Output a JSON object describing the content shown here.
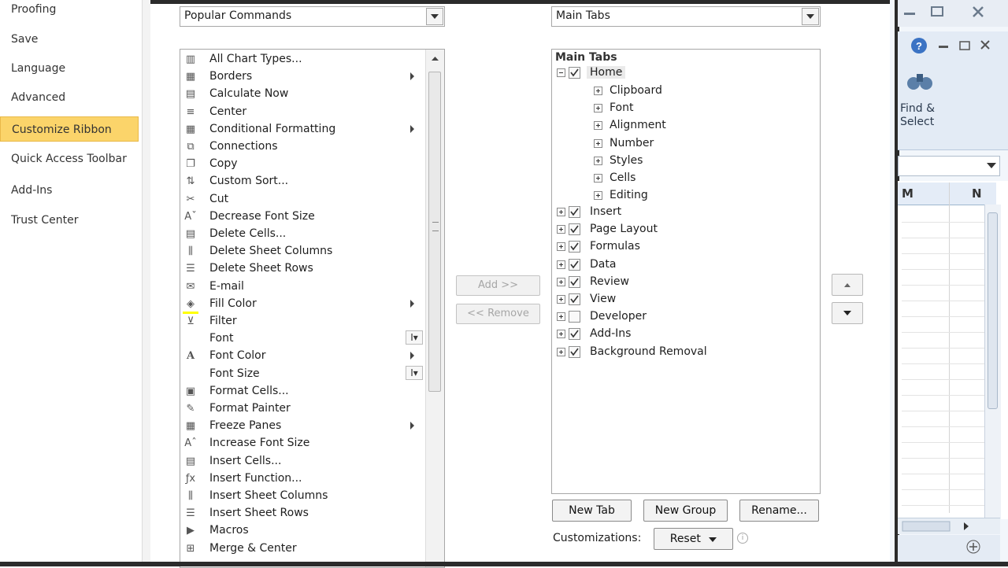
{
  "nav": {
    "items": [
      {
        "label": "Proofing",
        "active": false
      },
      {
        "label": "Save",
        "active": false
      },
      {
        "label": "Language",
        "active": false
      },
      {
        "label": "Advanced",
        "active": false
      },
      {
        "label": "Customize Ribbon",
        "active": true
      },
      {
        "label": "Quick Access Toolbar",
        "active": false
      },
      {
        "label": "Add-Ins",
        "active": false
      },
      {
        "label": "Trust Center",
        "active": false
      }
    ]
  },
  "choose_commands": {
    "selected": "Popular Commands"
  },
  "customize_ribbon": {
    "selected": "Main Tabs"
  },
  "commands": [
    {
      "label": "All Chart Types...",
      "icon": "chart-icon",
      "submenu": false
    },
    {
      "label": "Borders",
      "icon": "borders-icon",
      "submenu": true
    },
    {
      "label": "Calculate Now",
      "icon": "calculator-icon",
      "submenu": false
    },
    {
      "label": "Center",
      "icon": "align-center-icon",
      "submenu": false
    },
    {
      "label": "Conditional Formatting",
      "icon": "conditional-formatting-icon",
      "submenu": true
    },
    {
      "label": "Connections",
      "icon": "connections-icon",
      "submenu": false
    },
    {
      "label": "Copy",
      "icon": "copy-icon",
      "submenu": false
    },
    {
      "label": "Custom Sort...",
      "icon": "sort-icon",
      "submenu": false
    },
    {
      "label": "Cut",
      "icon": "scissors-icon",
      "submenu": false
    },
    {
      "label": "Decrease Font Size",
      "icon": "decrease-font-icon",
      "submenu": false
    },
    {
      "label": "Delete Cells...",
      "icon": "delete-cells-icon",
      "submenu": false
    },
    {
      "label": "Delete Sheet Columns",
      "icon": "delete-columns-icon",
      "submenu": false
    },
    {
      "label": "Delete Sheet Rows",
      "icon": "delete-rows-icon",
      "submenu": false
    },
    {
      "label": "E-mail",
      "icon": "email-icon",
      "submenu": false
    },
    {
      "label": "Fill Color",
      "icon": "fill-color-icon",
      "submenu": true
    },
    {
      "label": "Filter",
      "icon": "filter-icon",
      "submenu": false
    },
    {
      "label": "Font",
      "icon": "",
      "submenu": false,
      "ibeam": true
    },
    {
      "label": "Font Color",
      "icon": "font-color-icon",
      "submenu": true
    },
    {
      "label": "Font Size",
      "icon": "",
      "submenu": false,
      "ibeam": true
    },
    {
      "label": "Format Cells...",
      "icon": "format-cells-icon",
      "submenu": false
    },
    {
      "label": "Format Painter",
      "icon": "format-painter-icon",
      "submenu": false
    },
    {
      "label": "Freeze Panes",
      "icon": "freeze-panes-icon",
      "submenu": true
    },
    {
      "label": "Increase Font Size",
      "icon": "increase-font-icon",
      "submenu": false
    },
    {
      "label": "Insert Cells...",
      "icon": "insert-cells-icon",
      "submenu": false
    },
    {
      "label": "Insert Function...",
      "icon": "function-icon",
      "submenu": false
    },
    {
      "label": "Insert Sheet Columns",
      "icon": "insert-columns-icon",
      "submenu": false
    },
    {
      "label": "Insert Sheet Rows",
      "icon": "insert-rows-icon",
      "submenu": false
    },
    {
      "label": "Macros",
      "icon": "macros-icon",
      "submenu": false
    },
    {
      "label": "Merge & Center",
      "icon": "merge-center-icon",
      "submenu": false
    }
  ],
  "mid_buttons": {
    "add": "Add >>",
    "remove": "<< Remove"
  },
  "tree": {
    "header": "Main Tabs",
    "home": {
      "label": "Home",
      "checked": true,
      "groups": [
        "Clipboard",
        "Font",
        "Alignment",
        "Number",
        "Styles",
        "Cells",
        "Editing"
      ]
    },
    "tabs": [
      {
        "label": "Insert",
        "checked": true
      },
      {
        "label": "Page Layout",
        "checked": true
      },
      {
        "label": "Formulas",
        "checked": true
      },
      {
        "label": "Data",
        "checked": true
      },
      {
        "label": "Review",
        "checked": true
      },
      {
        "label": "View",
        "checked": true
      },
      {
        "label": "Developer",
        "checked": false
      },
      {
        "label": "Add-Ins",
        "checked": true
      },
      {
        "label": "Background Removal",
        "checked": true
      }
    ]
  },
  "bottom_buttons": {
    "new_tab": "New Tab",
    "new_group": "New Group",
    "rename": "Rename..."
  },
  "customizations": {
    "label": "Customizations:",
    "reset": "Reset"
  },
  "excel_bg": {
    "find_select": "Find &\nSelect",
    "col_m": "M",
    "col_n": "N"
  }
}
